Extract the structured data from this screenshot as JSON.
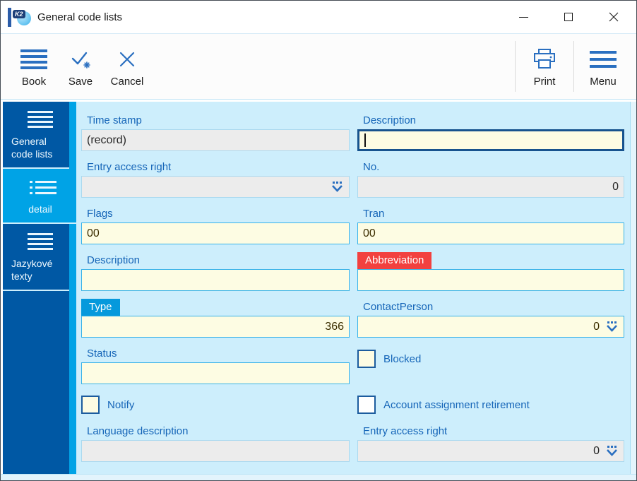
{
  "window": {
    "title": "General code lists",
    "controls": {
      "minimize": "minimize",
      "maximize": "maximize",
      "close": "close"
    }
  },
  "toolbar": {
    "book": "Book",
    "save": "Save",
    "cancel": "Cancel",
    "print": "Print",
    "menu": "Menu"
  },
  "sidebar": {
    "items": [
      {
        "label": "General code lists",
        "icon": "menu-lines-icon",
        "active": false
      },
      {
        "label": "detail",
        "icon": "detail-list-icon",
        "active": true
      },
      {
        "label": "Jazykové texty",
        "icon": "menu-lines-icon",
        "active": false
      }
    ]
  },
  "form": {
    "time_stamp": {
      "label": "Time stamp",
      "value": "(record)",
      "state": "readonly"
    },
    "description_header": {
      "label": "Description",
      "value": "",
      "state": "focused"
    },
    "entry_access_right_header": {
      "label": "Entry access right",
      "value": "",
      "state": "readonly-combo"
    },
    "no": {
      "label": "No.",
      "value": "0",
      "state": "readonly"
    },
    "flags": {
      "label": "Flags",
      "value": "00"
    },
    "tran": {
      "label": "Tran",
      "value": "00"
    },
    "description_detail": {
      "label": "Description",
      "value": ""
    },
    "abbreviation": {
      "label": "Abbreviation",
      "value": "",
      "label_style": "error-red"
    },
    "type": {
      "label": "Type",
      "value": "366",
      "label_style": "highlight-blue"
    },
    "contact_person": {
      "label": "ContactPerson",
      "value": "0",
      "state": "combo"
    },
    "status": {
      "label": "Status",
      "value": ""
    },
    "blocked": {
      "label": "Blocked",
      "checked": false
    },
    "notify": {
      "label": "Notify",
      "checked": false
    },
    "account_assignment_retirement": {
      "label": "Account assignment retirement",
      "checked": false
    },
    "language_description": {
      "label": "Language description",
      "value": "",
      "state": "readonly"
    },
    "entry_access_right_footer": {
      "label": "Entry access right",
      "value": "0",
      "state": "readonly-combo"
    }
  },
  "colors": {
    "sidebar_blue": "#0058a4",
    "active_cyan": "#00a3e6",
    "form_background": "#cdeefc",
    "field_yellow": "#fdfce3",
    "field_border_cyan": "#38b2e8",
    "readonly_gray": "#ececec",
    "label_blue": "#1565b8",
    "error_red": "#f2413f",
    "highlight_blue": "#0599dc",
    "toolbar_icon_blue": "#2a6fc0",
    "focus_border": "#17538e"
  }
}
